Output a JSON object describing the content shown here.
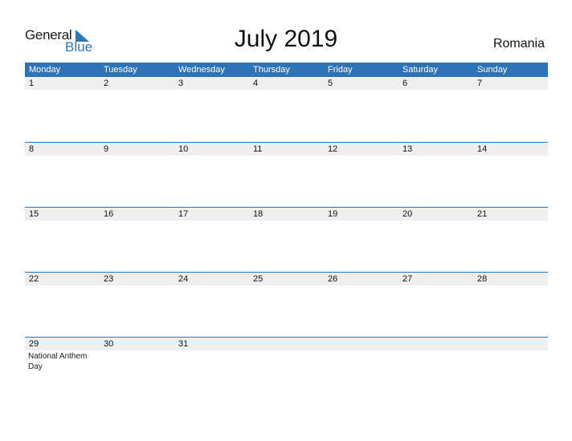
{
  "logo": {
    "text1": "General",
    "text2": "Blue"
  },
  "title": "July 2019",
  "country": "Romania",
  "colors": {
    "accent": "#2e73b5",
    "date_row_bg": "#efefef"
  },
  "weekdays": [
    "Monday",
    "Tuesday",
    "Wednesday",
    "Thursday",
    "Friday",
    "Saturday",
    "Sunday"
  ],
  "weeks": [
    {
      "days": [
        "1",
        "2",
        "3",
        "4",
        "5",
        "6",
        "7"
      ],
      "events": [
        "",
        "",
        "",
        "",
        "",
        "",
        ""
      ]
    },
    {
      "days": [
        "8",
        "9",
        "10",
        "11",
        "12",
        "13",
        "14"
      ],
      "events": [
        "",
        "",
        "",
        "",
        "",
        "",
        ""
      ]
    },
    {
      "days": [
        "15",
        "16",
        "17",
        "18",
        "19",
        "20",
        "21"
      ],
      "events": [
        "",
        "",
        "",
        "",
        "",
        "",
        ""
      ]
    },
    {
      "days": [
        "22",
        "23",
        "24",
        "25",
        "26",
        "27",
        "28"
      ],
      "events": [
        "",
        "",
        "",
        "",
        "",
        "",
        ""
      ]
    },
    {
      "days": [
        "29",
        "30",
        "31",
        "",
        "",
        "",
        ""
      ],
      "events": [
        "National Anthem Day",
        "",
        "",
        "",
        "",
        "",
        ""
      ]
    }
  ]
}
